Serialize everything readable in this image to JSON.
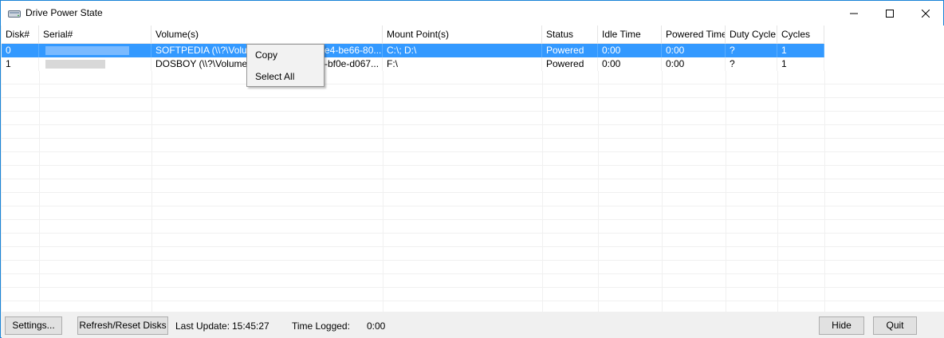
{
  "window": {
    "title": "Drive Power State"
  },
  "columns": [
    "Disk#",
    "Serial#",
    "Volume(s)",
    "Mount Point(s)",
    "Status",
    "Idle Time",
    "Powered Time",
    "Duty Cycle",
    "Cycles"
  ],
  "rows": [
    {
      "disk": "0",
      "serial": "",
      "volume": "SOFTPEDIA (\\\\?\\Volume",
      "volume_tail": "e4-be66-80...",
      "mount": "C:\\; D:\\",
      "status": "Powered",
      "idle": "0:00",
      "powered": "0:00",
      "duty": "?",
      "cycles": "1",
      "selected": true
    },
    {
      "disk": "1",
      "serial": "",
      "volume": "DOSBOY (\\\\?\\Volume{a",
      "volume_tail": "-bf0e-d067...",
      "mount": "F:\\",
      "status": "Powered",
      "idle": "0:00",
      "powered": "0:00",
      "duty": "?",
      "cycles": "1",
      "selected": false
    }
  ],
  "context_menu": {
    "copy": "Copy",
    "select_all": "Select All"
  },
  "watermark": "SOFTPEDIA",
  "footer": {
    "settings": "Settings...",
    "refresh": "Refresh/Reset Disks",
    "last_update_label": "Last Update:",
    "last_update_value": "15:45:27",
    "time_logged_label": "Time Logged:",
    "time_logged_value": "0:00",
    "hide": "Hide",
    "quit": "Quit"
  },
  "icons": {
    "app": "drive-icon",
    "minimize": "minimize-icon",
    "maximize": "maximize-icon",
    "close": "close-icon"
  },
  "colors": {
    "selection": "#3399ff",
    "window_border": "#1883d7"
  }
}
